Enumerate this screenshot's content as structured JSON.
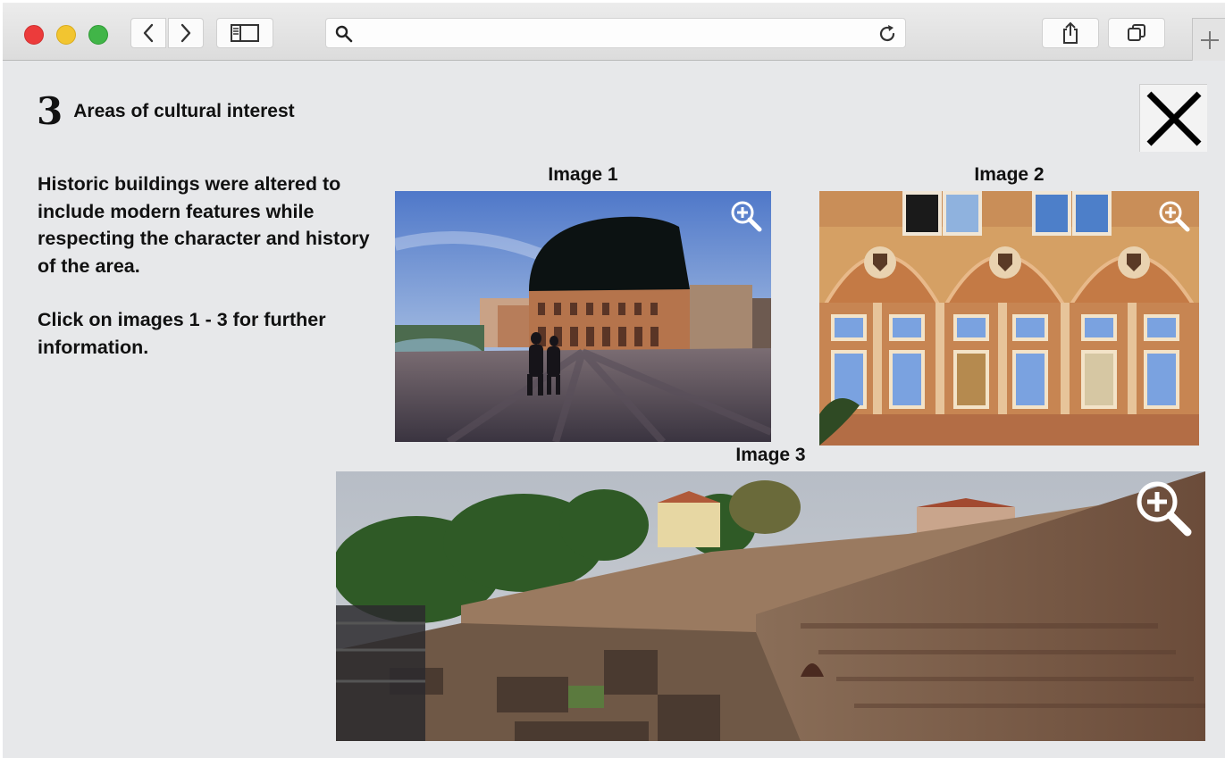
{
  "browser": {
    "address": ""
  },
  "page": {
    "heading_number": "3",
    "heading_title": "Areas of cultural interest",
    "paragraph_1": "Historic buildings were altered to include modern features while respecting the character and history of the area.",
    "paragraph_2": "Click on images 1 - 3 for further information."
  },
  "images": [
    {
      "label": "Image 1",
      "icon": "zoom-in-icon"
    },
    {
      "label": "Image 2",
      "icon": "zoom-in-icon"
    },
    {
      "label": "Image 3",
      "icon": "zoom-in-icon"
    }
  ],
  "colors": {
    "page_background": "#e7e8ea",
    "traffic_red": "#ec3b3b",
    "traffic_yellow": "#f2c530",
    "traffic_green": "#41b548"
  }
}
